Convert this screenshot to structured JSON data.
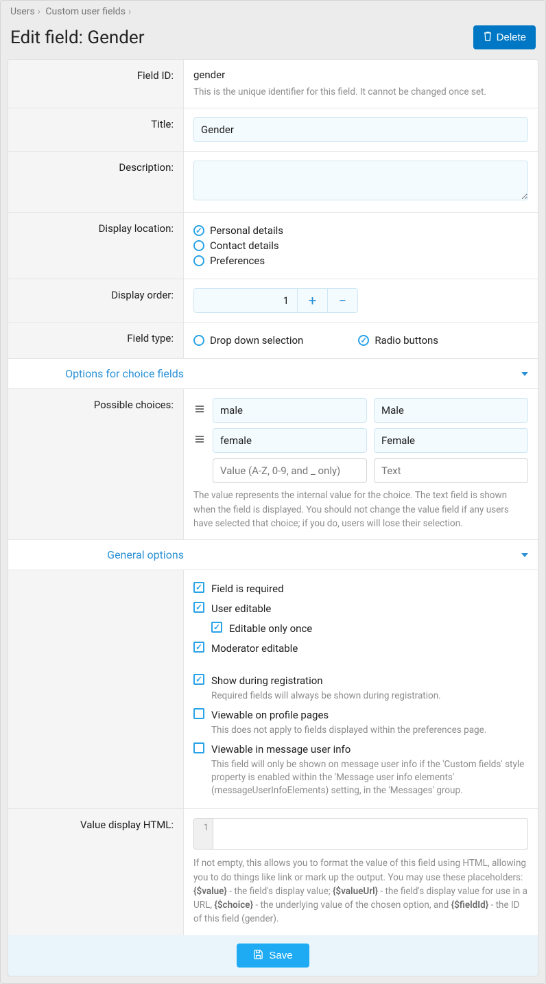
{
  "breadcrumb": {
    "users": "Users",
    "fields": "Custom user fields"
  },
  "title": "Edit field: Gender",
  "delete_btn": "Delete",
  "labels": {
    "field_id": "Field ID:",
    "title": "Title:",
    "description": "Description:",
    "disp_loc": "Display location:",
    "disp_order": "Display order:",
    "field_type": "Field type:",
    "poss": "Possible choices:",
    "vhtml": "Value display HTML:"
  },
  "field_id": "gender",
  "field_id_hint": "This is the unique identifier for this field. It cannot be changed once set.",
  "title_val": "Gender",
  "loc": {
    "personal": "Personal details",
    "contact": "Contact details",
    "prefs": "Preferences"
  },
  "order": "1",
  "ftype": {
    "dd": "Drop down selection",
    "radio": "Radio buttons"
  },
  "sect_choices": "Options for choice fields",
  "choices": [
    {
      "v": "male",
      "t": "Male"
    },
    {
      "v": "female",
      "t": "Female"
    }
  ],
  "choice_ph": {
    "v": "Value (A-Z, 0-9, and _ only)",
    "t": "Text"
  },
  "choice_hint": "The value represents the internal value for the choice. The text field is shown when the field is displayed. You should not change the value field if any users have selected that choice; if you do, users will lose their selection.",
  "sect_general": "General options",
  "gen": {
    "required": "Field is required",
    "usered": "User editable",
    "once": "Editable only once",
    "moded": "Moderator editable",
    "showreg": "Show during registration",
    "showreg_h": "Required fields will always be shown during registration.",
    "viewprof": "Viewable on profile pages",
    "viewprof_h": "This does not apply to fields displayed within the preferences page.",
    "viewmsg": "Viewable in message user info",
    "viewmsg_h": "This field will only be shown on message user info if the 'Custom fields' style property is enabled within the 'Message user info elements' (messageUserInfoElements) setting, in the 'Messages' group."
  },
  "ln1": "1",
  "vhtml_hint_pre": "If not empty, this allows you to format the value of this field using HTML, allowing you to do things like link or mark up the output. You may use these placeholders: ",
  "ph1": "{$value}",
  "ph1_d": " - the field's display value; ",
  "ph2": "{$valueUrl}",
  "ph2_d": " - the field's display value for use in a URL, ",
  "ph3": "{$choice}",
  "ph3_d": " - the underlying value of the chosen option, and ",
  "ph4": "{$fieldId}",
  "ph4_d": " - the ID of this field (gender).",
  "save": "Save"
}
